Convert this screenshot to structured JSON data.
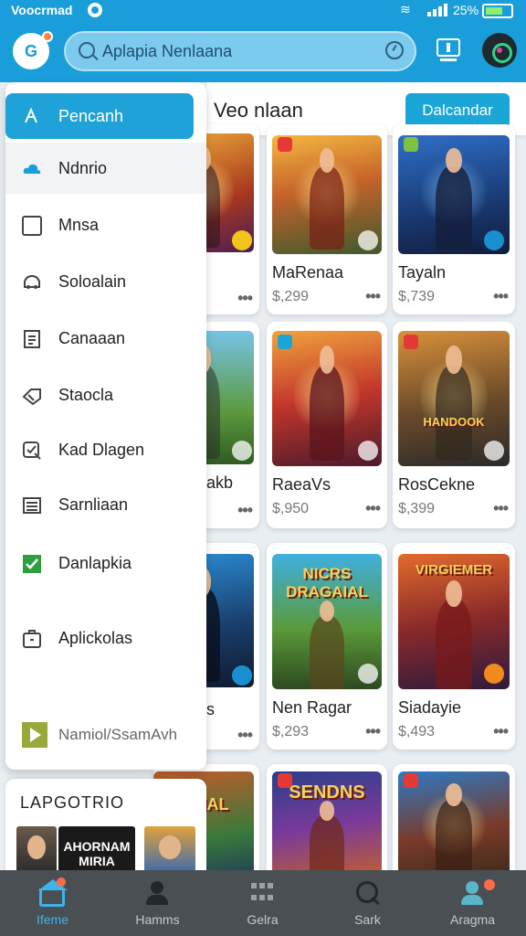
{
  "status_bar": {
    "carrier": "Voocrmad",
    "battery": "25%"
  },
  "app_bar": {
    "logo_text": "G",
    "search_placeholder": "Aplapia Nenlaana"
  },
  "main": {
    "title": "Veo nlaan",
    "download_label": "Dalcandar"
  },
  "drawer": {
    "items": [
      {
        "label": "Pencanh",
        "icon": "cursor-icon"
      },
      {
        "label": "Ndnrio",
        "icon": "cloud-icon"
      },
      {
        "label": "Mnsa",
        "icon": "calendar-icon"
      },
      {
        "label": "Soloalain",
        "icon": "car-icon"
      },
      {
        "label": "Canaaan",
        "icon": "document-icon"
      },
      {
        "label": "Staocla",
        "icon": "tag-icon"
      },
      {
        "label": "Kad Dlagen",
        "icon": "badge-check-icon"
      },
      {
        "label": "Sarnliaan",
        "icon": "list-icon"
      },
      {
        "label": "Danlapkia",
        "icon": "check-box-icon"
      },
      {
        "label": "Aplickolas",
        "icon": "briefcase-icon"
      },
      {
        "label": "Namiol/SsamAvh",
        "icon": "play-store-icon"
      }
    ]
  },
  "categories": {
    "title": "LAPGOTRIO",
    "thumb_text": "AHORNAM MIRIA"
  },
  "games": [
    {
      "name": "",
      "price": ""
    },
    {
      "name": "MaRenaa",
      "price": "$,299"
    },
    {
      "name": "Tayaln",
      "price": "$,739"
    },
    {
      "name": "akb",
      "price": ""
    },
    {
      "name": "RaeaVs",
      "price": "$,950"
    },
    {
      "name": "RosCekne",
      "price": "$,399"
    },
    {
      "name": "s",
      "price": ""
    },
    {
      "name": "Nen Ragar",
      "price": "$,293"
    },
    {
      "name": "Siadayie",
      "price": "$,493"
    },
    {
      "name": "",
      "price": ""
    },
    {
      "name": "",
      "price": ""
    },
    {
      "name": "",
      "price": ""
    }
  ],
  "art_texts": {
    "card5": "HANDOOK",
    "card7": "NICRS DRAGAIAL",
    "card8": "VIRGIEMER",
    "card10": "SENDNS",
    "card9": "RNIAL"
  },
  "bottom_nav": {
    "items": [
      {
        "label": "Ifeme",
        "icon": "home-icon"
      },
      {
        "label": "Hamms",
        "icon": "person-icon"
      },
      {
        "label": "Gelra",
        "icon": "grid-icon"
      },
      {
        "label": "Sark",
        "icon": "search-icon"
      },
      {
        "label": "Aragma",
        "icon": "account-icon"
      }
    ]
  },
  "colors": {
    "primary": "#1a9ed9",
    "accent": "#1fa2d8",
    "nav_bg": "#4a4f54"
  }
}
